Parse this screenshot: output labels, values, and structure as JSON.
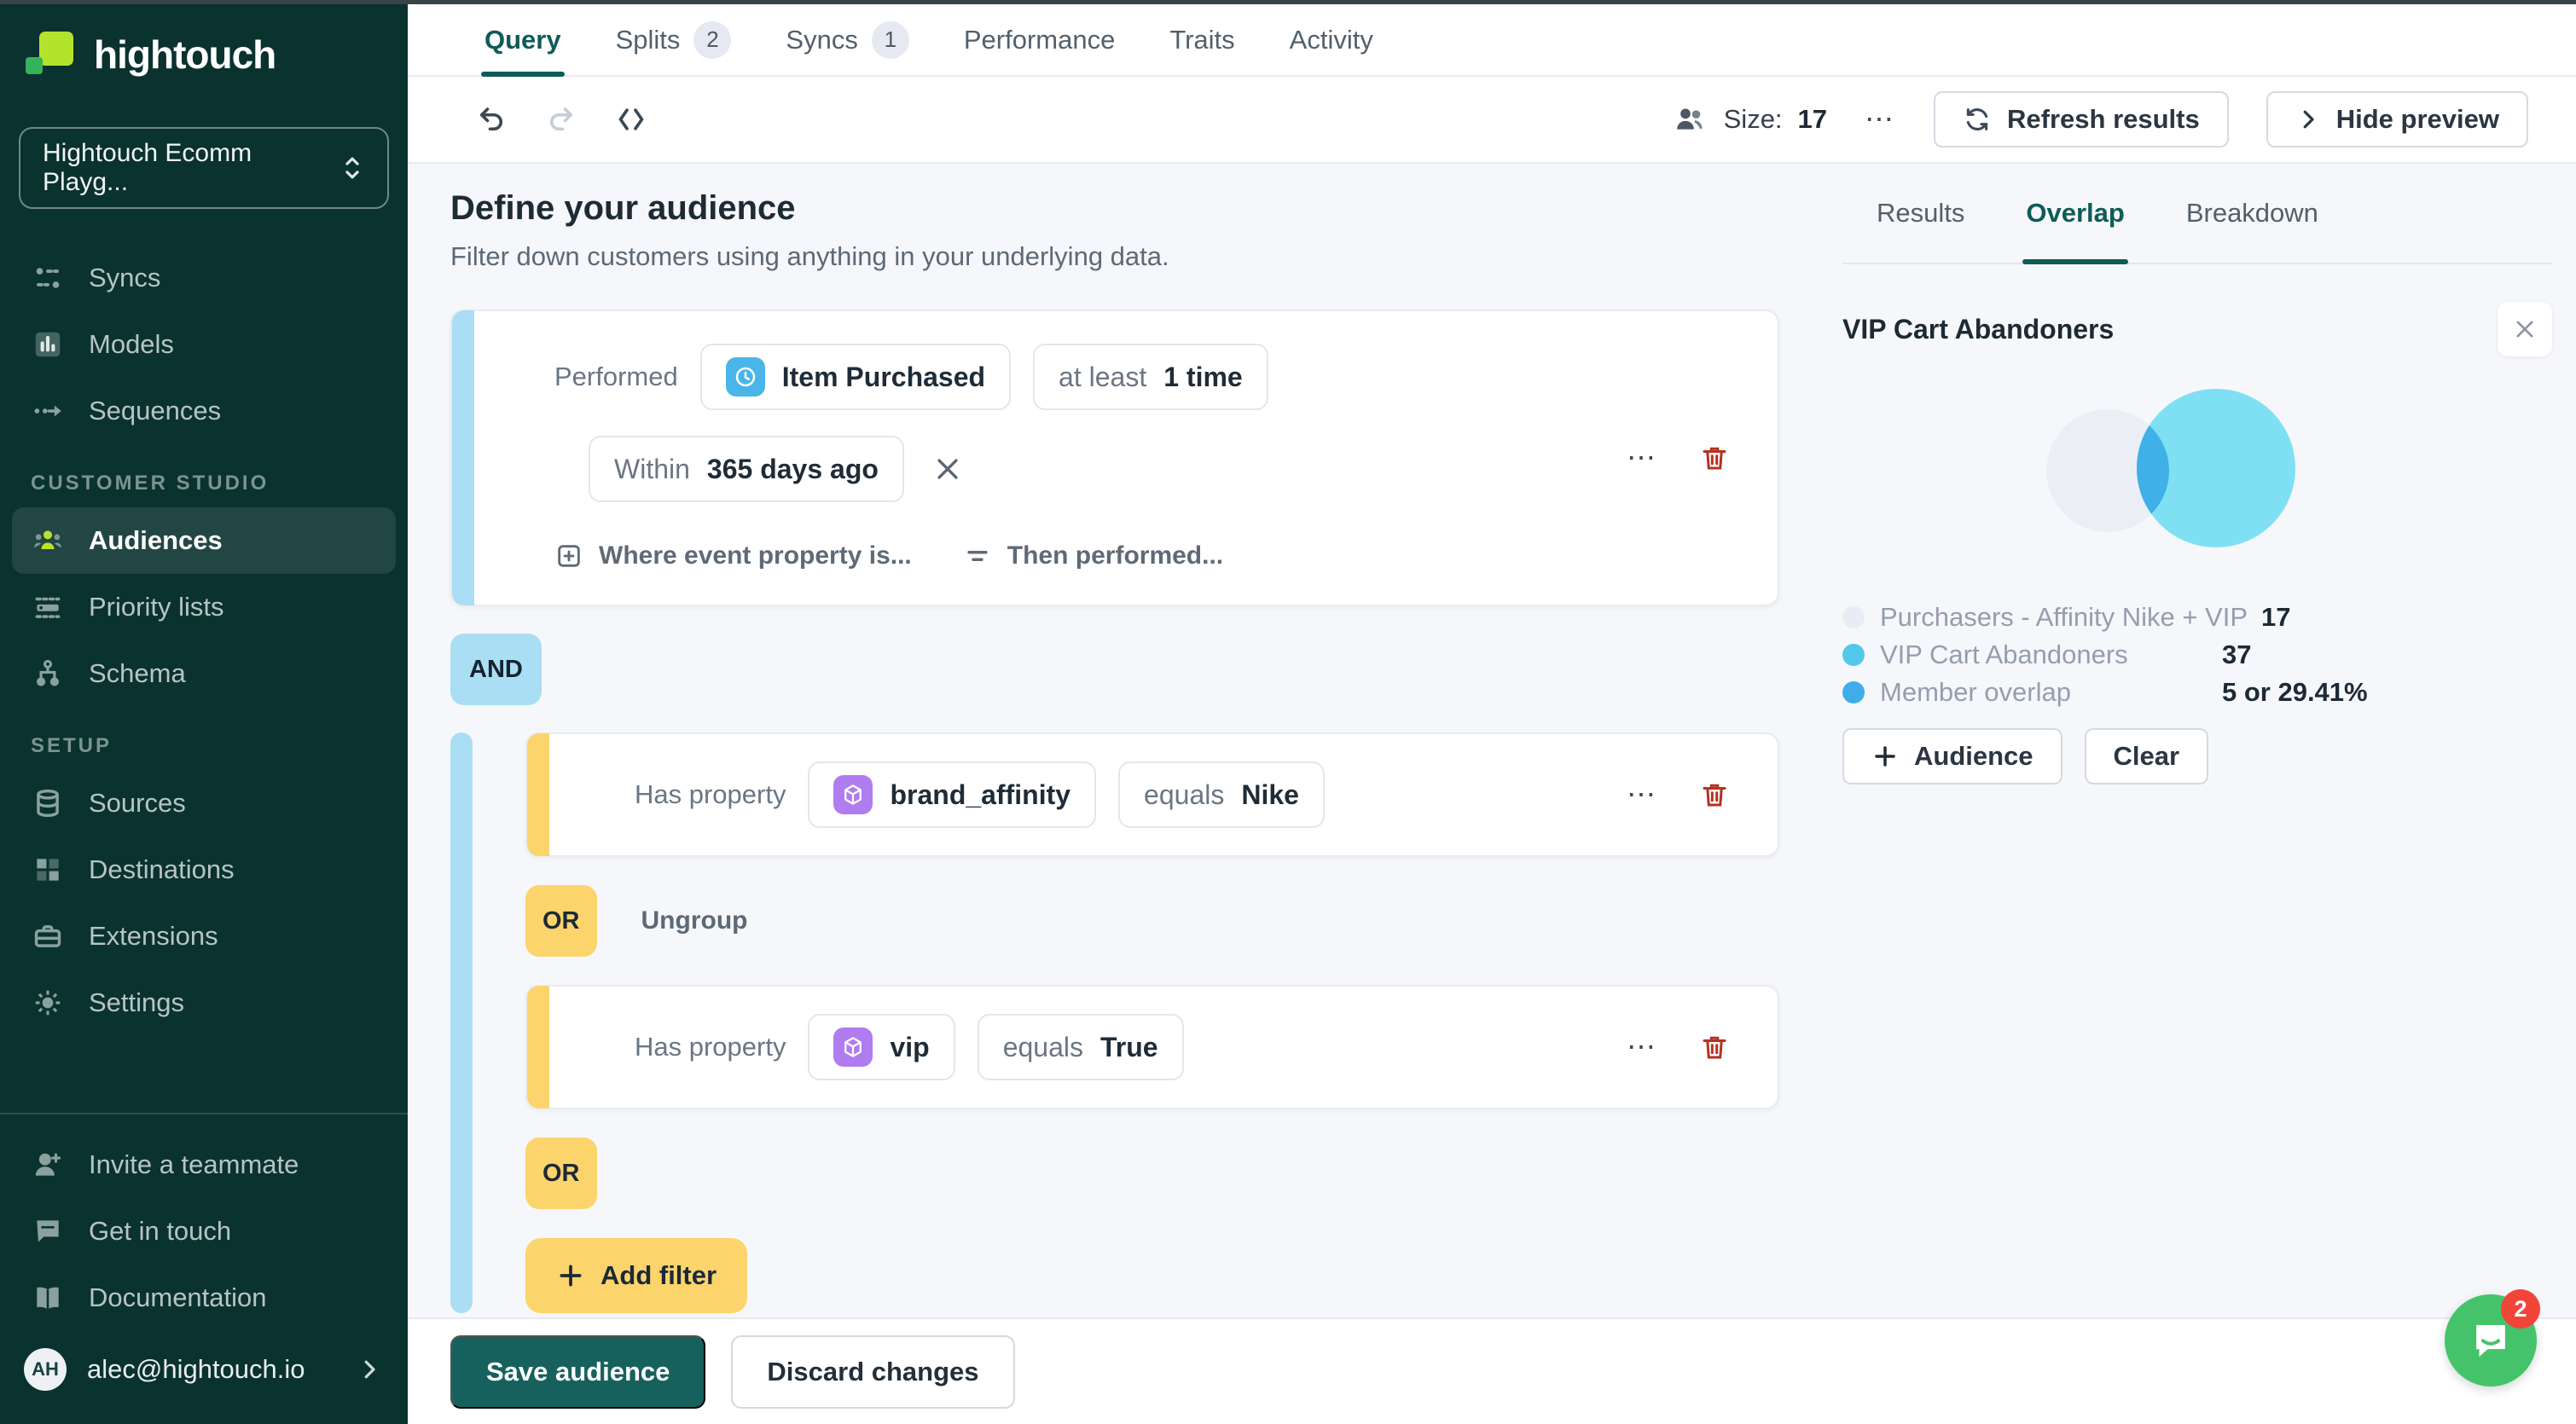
{
  "sidebar": {
    "brand": "hightouch",
    "workspace": "Hightouch Ecomm Playg...",
    "nav": [
      {
        "label": "Syncs",
        "icon": "syncs-icon"
      },
      {
        "label": "Models",
        "icon": "models-icon"
      },
      {
        "label": "Sequences",
        "icon": "sequences-icon"
      }
    ],
    "customer_studio": {
      "label": "CUSTOMER STUDIO",
      "items": [
        {
          "label": "Audiences",
          "icon": "audiences-icon",
          "active": true
        },
        {
          "label": "Priority lists",
          "icon": "priority-lists-icon"
        },
        {
          "label": "Schema",
          "icon": "schema-icon"
        }
      ]
    },
    "setup": {
      "label": "SETUP",
      "items": [
        {
          "label": "Sources",
          "icon": "database-icon"
        },
        {
          "label": "Destinations",
          "icon": "grid-icon"
        },
        {
          "label": "Extensions",
          "icon": "briefcase-icon"
        },
        {
          "label": "Settings",
          "icon": "gear-icon"
        }
      ]
    },
    "links": [
      {
        "label": "Invite a teammate",
        "icon": "person-plus-icon"
      },
      {
        "label": "Get in touch",
        "icon": "chat-icon"
      },
      {
        "label": "Documentation",
        "icon": "book-icon"
      }
    ],
    "account": {
      "initials": "AH",
      "email": "alec@hightouch.io"
    }
  },
  "header": {
    "tabs": [
      {
        "label": "Query",
        "active": true
      },
      {
        "label": "Splits",
        "badge": "2"
      },
      {
        "label": "Syncs",
        "badge": "1"
      },
      {
        "label": "Performance"
      },
      {
        "label": "Traits"
      },
      {
        "label": "Activity"
      }
    ]
  },
  "toolbar": {
    "size_label": "Size:",
    "size_value": "17",
    "more": "⋯",
    "refresh_label": "Refresh results",
    "hide_label": "Hide preview"
  },
  "query": {
    "title": "Define your audience",
    "subtitle": "Filter down customers using anything in your underlying data.",
    "event_card": {
      "performed_label": "Performed",
      "event_name": "Item Purchased",
      "event_icon": "clock-icon",
      "freq_prefix": "at least",
      "freq_value": "1 time",
      "window_prefix": "Within",
      "window_value": "365 days ago",
      "more": "⋯",
      "add_property_label": "Where event property is...",
      "then_performed_label": "Then performed..."
    },
    "and_label": "AND",
    "group": {
      "or_label": "OR",
      "ungroup_label": "Ungroup",
      "add_filter_label": "Add filter",
      "rows": [
        {
          "label": "Has property",
          "icon": "cube-icon",
          "property": "brand_affinity",
          "op_prefix": "equals",
          "op_value": "Nike",
          "more": "⋯"
        },
        {
          "label": "Has property",
          "icon": "cube-icon",
          "property": "vip",
          "op_prefix": "equals",
          "op_value": "True",
          "more": "⋯"
        }
      ]
    }
  },
  "preview": {
    "tabs": [
      {
        "label": "Results"
      },
      {
        "label": "Overlap",
        "active": true
      },
      {
        "label": "Breakdown"
      }
    ],
    "compare_title": "VIP Cart Abandoners",
    "venn": {
      "left_size": 17,
      "right_size": 37,
      "overlap_count": 5,
      "overlap_percent": "29.41%",
      "colors": {
        "left": "#ebeef5",
        "right": "#7fe0f3",
        "overlap": "#3fb0e8"
      }
    },
    "legend": [
      {
        "label": "Purchasers - Affinity Nike + VIP",
        "value": "17",
        "swatch": "#e8ecf4"
      },
      {
        "label": "VIP Cart Abandoners",
        "value": "37",
        "swatch": "#52c9ec"
      },
      {
        "label": "Member overlap",
        "value": "5 or 29.41%",
        "swatch": "#3fadea"
      }
    ],
    "audience_button_label": "Audience",
    "clear_label": "Clear"
  },
  "footer": {
    "save_label": "Save audience",
    "discard_label": "Discard changes"
  },
  "chat": {
    "badge": "2"
  },
  "colors": {
    "sidebar_bg": "#0a322f",
    "accent_teal": "#0d5c57",
    "save_teal": "#16615e",
    "logo_lime": "#b4e32c",
    "logo_green": "#36b35a",
    "group_blue": "#a9def4",
    "group_yellow": "#fbd46c",
    "event_blue": "#49b5e8",
    "property_purple": "#b07df0",
    "trash_red": "#b5311f",
    "chat_green": "#45c36b",
    "notification_red": "#f2453a"
  }
}
